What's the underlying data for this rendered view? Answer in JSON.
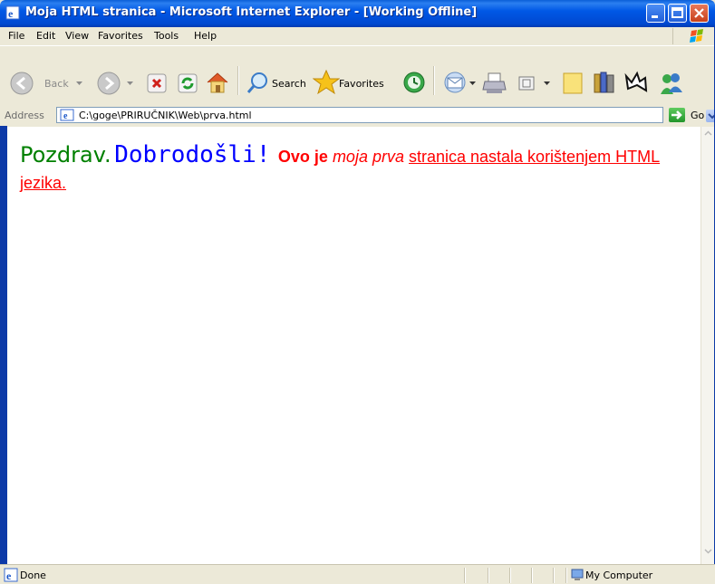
{
  "window": {
    "title": "Moja HTML stranica - Microsoft Internet Explorer - [Working Offline]"
  },
  "menu": [
    "File",
    "Edit",
    "View",
    "Favorites",
    "Tools",
    "Help"
  ],
  "toolbar": {
    "back_label": "Back",
    "search_label": "Search",
    "favorites_label": "Favorites"
  },
  "address": {
    "label": "Address",
    "url": "C:\\goge\\PRIRUČNIK\\Web\\prva.html",
    "go_label": "Go"
  },
  "page": {
    "greeting": "Pozdrav.",
    "welcome": "Dobrodošli!",
    "bold_text": "Ovo je",
    "italic_text": "moja prva",
    "underlined_text": "stranica nastala korištenjem HTML jezika."
  },
  "status": {
    "text": "Done",
    "zone": "My Computer"
  },
  "colors": {
    "greeting": "#008000",
    "welcome": "#0000ff",
    "body_text": "#ff0000",
    "titlebar": "#0054e3"
  }
}
